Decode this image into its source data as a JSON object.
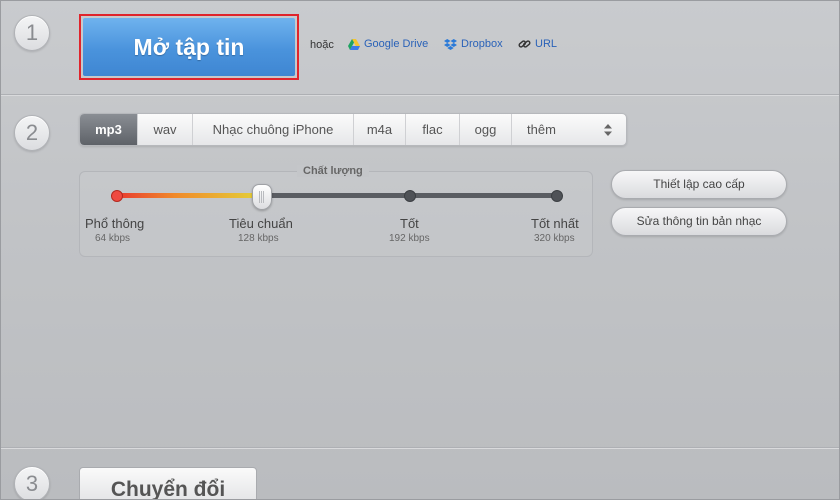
{
  "steps": [
    "1",
    "2",
    "3"
  ],
  "open": {
    "label": "Mở tập tin",
    "or_text": "hoặc",
    "sources": [
      {
        "label": "Google Drive",
        "icon": "google-drive-icon"
      },
      {
        "label": "Dropbox",
        "icon": "dropbox-icon"
      },
      {
        "label": "URL",
        "icon": "link-icon"
      }
    ]
  },
  "formats": {
    "tabs": [
      "mp3",
      "wav",
      "Nhạc chuông iPhone",
      "m4a",
      "flac",
      "ogg"
    ],
    "more_label": "thêm",
    "selected": "mp3"
  },
  "quality": {
    "title": "Chất lượng",
    "selected_index": 1,
    "levels": [
      {
        "label": "Phổ thông",
        "bitrate": "64 kbps"
      },
      {
        "label": "Tiêu chuẩn",
        "bitrate": "128 kbps"
      },
      {
        "label": "Tốt",
        "bitrate": "192 kbps"
      },
      {
        "label": "Tốt nhất",
        "bitrate": "320 kbps"
      }
    ]
  },
  "options": {
    "advanced_label": "Thiết lập cao cấp",
    "edit_info_label": "Sửa thông tin bản nhạc"
  },
  "convert": {
    "label": "Chuyển đổi"
  },
  "colors": {
    "accent_blue": "#4a93dc",
    "highlight_red": "#e0242c",
    "link_blue": "#2a62b8"
  }
}
